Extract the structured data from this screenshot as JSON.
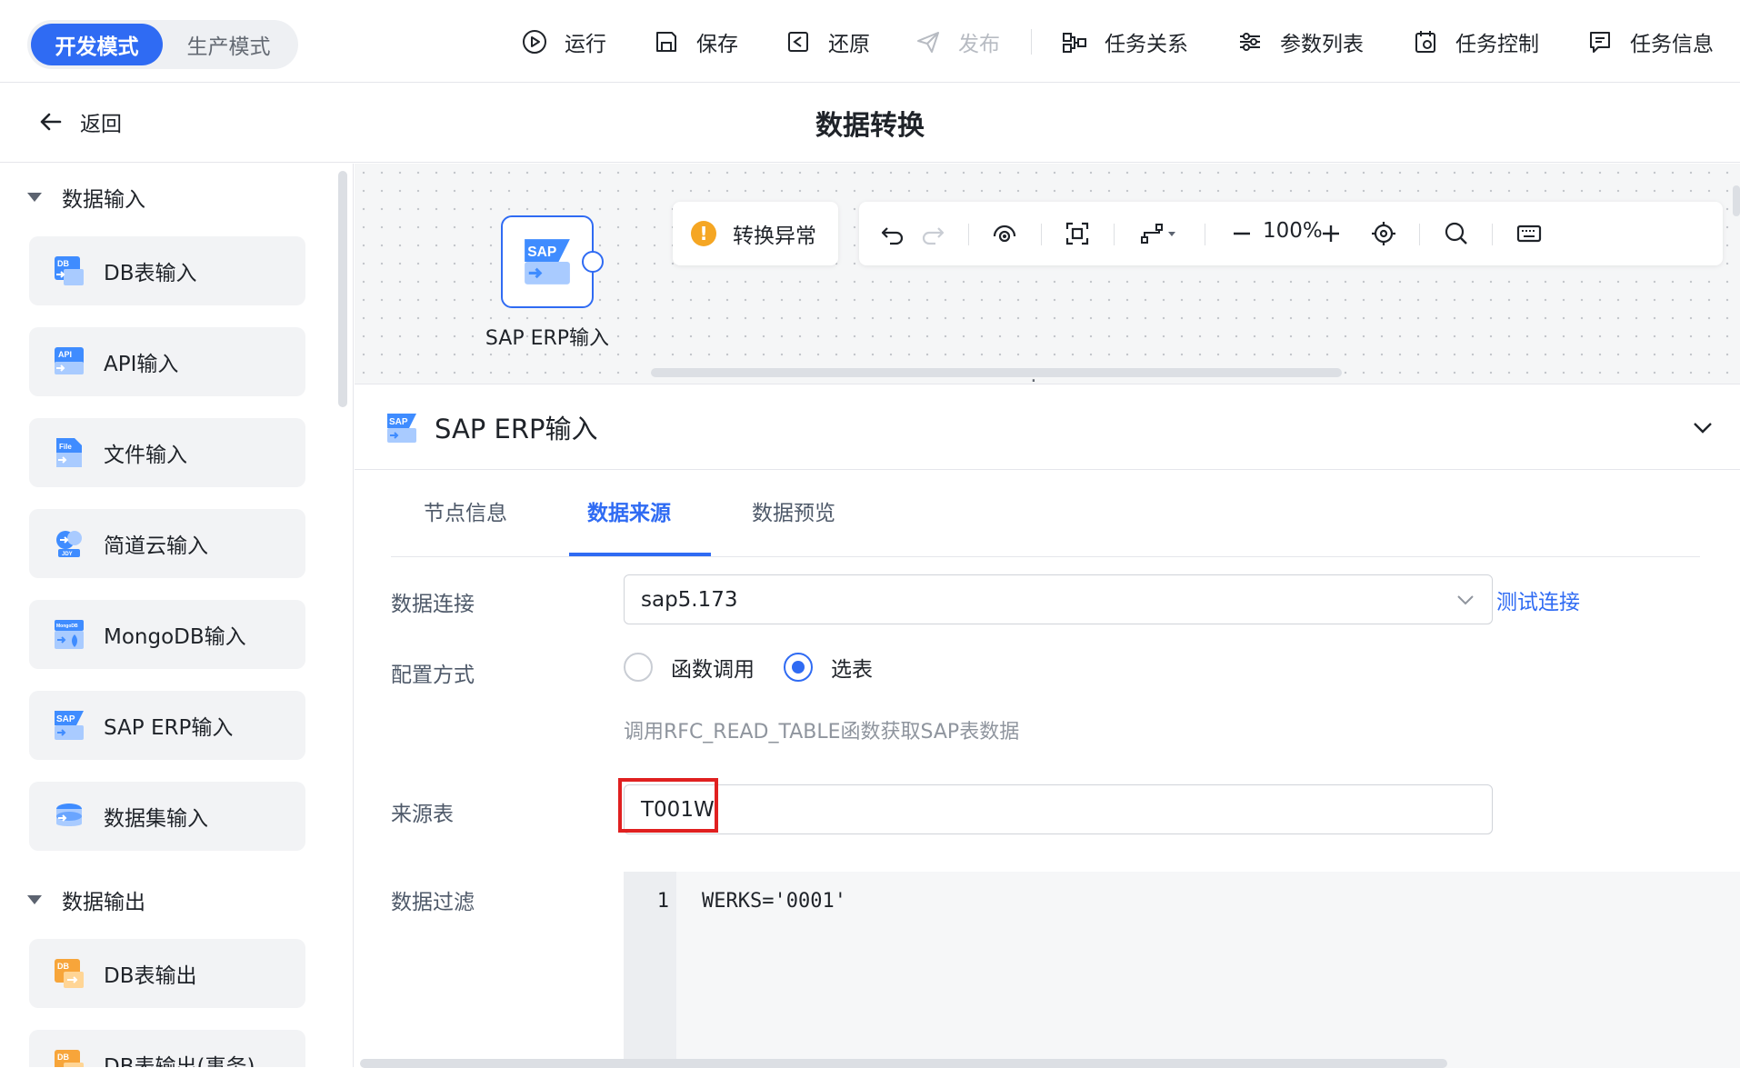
{
  "topbar": {
    "mode_dev": "开发模式",
    "mode_prod": "生产模式",
    "run": "运行",
    "save": "保存",
    "restore": "还原",
    "publish": "发布",
    "task_relation": "任务关系",
    "param_list": "参数列表",
    "task_control": "任务控制",
    "task_info": "任务信息"
  },
  "subbar": {
    "back": "返回",
    "title": "数据转换"
  },
  "sidebar": {
    "input_group": "数据输入",
    "input_items": [
      "DB表输入",
      "API输入",
      "文件输入",
      "简道云输入",
      "MongoDB输入",
      "SAP ERP输入",
      "数据集输入"
    ],
    "output_group": "数据输出",
    "output_items": [
      "DB表输出",
      "DB表输出(事务)"
    ],
    "icon_texts": [
      "DB",
      "API",
      "File",
      "JDY",
      "MongoDB",
      "SAP",
      "DB",
      "DB"
    ]
  },
  "canvas": {
    "node_label": "SAP ERP输入",
    "node_icon_text": "SAP",
    "warning": "转换异常",
    "zoom": "100%"
  },
  "panel": {
    "icon_text": "SAP",
    "title": "SAP ERP输入",
    "tabs": [
      "节点信息",
      "数据来源",
      "数据预览"
    ],
    "active_tab": "数据来源",
    "conn_label": "数据连接",
    "conn_value": "sap5.173",
    "test_link": "测试连接",
    "config_label": "配置方式",
    "radio_func": "函数调用",
    "radio_table": "选表",
    "selected_radio": "选表",
    "hint": "调用RFC_READ_TABLE函数获取SAP表数据",
    "source_label": "来源表",
    "source_value": "T001W",
    "filter_label": "数据过滤",
    "filter_line_no": "1",
    "filter_code": "WERKS='0001'"
  },
  "colors": {
    "accent": "#2f6bf3",
    "warning": "#f5a623",
    "highlight": "#e02020"
  }
}
